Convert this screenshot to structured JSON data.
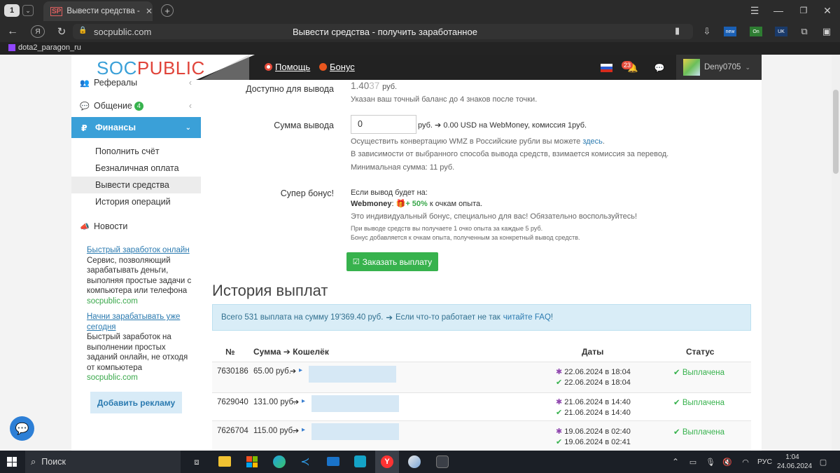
{
  "browser": {
    "tab_counter": "1",
    "tab_favicon": "SP",
    "tab_title": "Вывести средства - пол",
    "address": "socpublic.com",
    "page_title": "Вывести средства - получить заработанное",
    "bookmark": "dota2_paragon_ru",
    "ext_badges": {
      "new": "new",
      "on": "On",
      "uk": "UK"
    }
  },
  "site": {
    "logo_prefix": "SOC",
    "logo_suffix": "PUBLIC",
    "help": "Помощь",
    "bonus": "Бонус",
    "notif_count": "23",
    "username": "Deny0705",
    "accent": "#3aa0d8",
    "green": "#37b24d"
  },
  "sidebar": {
    "referrals": "Рефералы",
    "chat": "Общение",
    "chat_badge": "4",
    "finance": "Финансы",
    "sub": [
      "Пополнить счёт",
      "Безналичная оплата",
      "Вывести средства",
      "История операций"
    ],
    "news": "Новости",
    "promo1_title": "Быстрый заработок онлайн",
    "promo1_text": "Сервис, позволяющий зарабатывать деньги, выполняя простые задачи с компьютера или телефона",
    "promo1_site": "socpublic.com",
    "promo2_title": "Начни зарабатывать уже сегодня",
    "promo2_text": "Быстрый заработок на выполнении простых заданий онлайн, не отходя от компьютера",
    "promo2_site": "socpublic.com",
    "add_ad": "Добавить рекламу"
  },
  "form": {
    "avail_label": "Доступно для вывода",
    "balance_main": "1.40",
    "balance_tail": "37",
    "balance_unit": "руб.",
    "balance_note": "Указан ваш точный баланс до 4 знаков после точки.",
    "sum_label": "Сумма вывода",
    "sum_value": "0",
    "sum_unit": "руб.",
    "conversion": "0.00 USD на WebMoney, комиссия 1руб.",
    "note1_pre": "Осуществить конвертацию WMZ в Российские рубли вы можете ",
    "note1_link": "здесь",
    "note1_post": ".",
    "note2": "В зависимости от выбранного способа вывода средств, взимается комиссия за перевод.",
    "note3": "Минимальная сумма: 11 руб.",
    "bonus_label": "Супер бонус!",
    "bonus_if": "Если вывод будет на:",
    "bonus_wm": "Webmoney",
    "bonus_colon": ":",
    "bonus_pct": "+ 50%",
    "bonus_rest": "к очкам опыта.",
    "bonus_individual": "Это индивидуальный бонус, специально для вас! Обязательно воспользуйтесь!",
    "bonus_small1": "При выводе средств вы получаете 1 очко опыта за каждые 5 руб.",
    "bonus_small2": "Бонус добавляется к очкам опыта, полученным за конкретный вывод средств.",
    "submit": "Заказать выплату"
  },
  "history": {
    "title": "История выплат",
    "info_pre": "Всего 531 выплата на сумму 19'369.40 руб.",
    "info_mid": "Если что-то работает не так",
    "info_link": "читайте FAQ",
    "info_end": "!",
    "col_num": "№",
    "col_sum": "Сумма",
    "col_wallet": "Кошелёк",
    "col_dates": "Даты",
    "col_status": "Статус",
    "rows": [
      {
        "num": "7630186",
        "sum": "65.00 руб.",
        "d1": "22.06.2024 в 18:04",
        "d2": "22.06.2024 в 18:04",
        "status": "Выплачена"
      },
      {
        "num": "7629040",
        "sum": "131.00 руб.",
        "d1": "21.06.2024 в 14:40",
        "d2": "21.06.2024 в 14:40",
        "status": "Выплачена"
      },
      {
        "num": "7626704",
        "sum": "115.00 руб.",
        "d1": "19.06.2024 в 02:40",
        "d2": "19.06.2024 в 02:41",
        "status": "Выплачена"
      }
    ]
  },
  "taskbar": {
    "search": "Поиск",
    "lang": "РУС",
    "time": "1:04",
    "date": "24.06.2024"
  }
}
